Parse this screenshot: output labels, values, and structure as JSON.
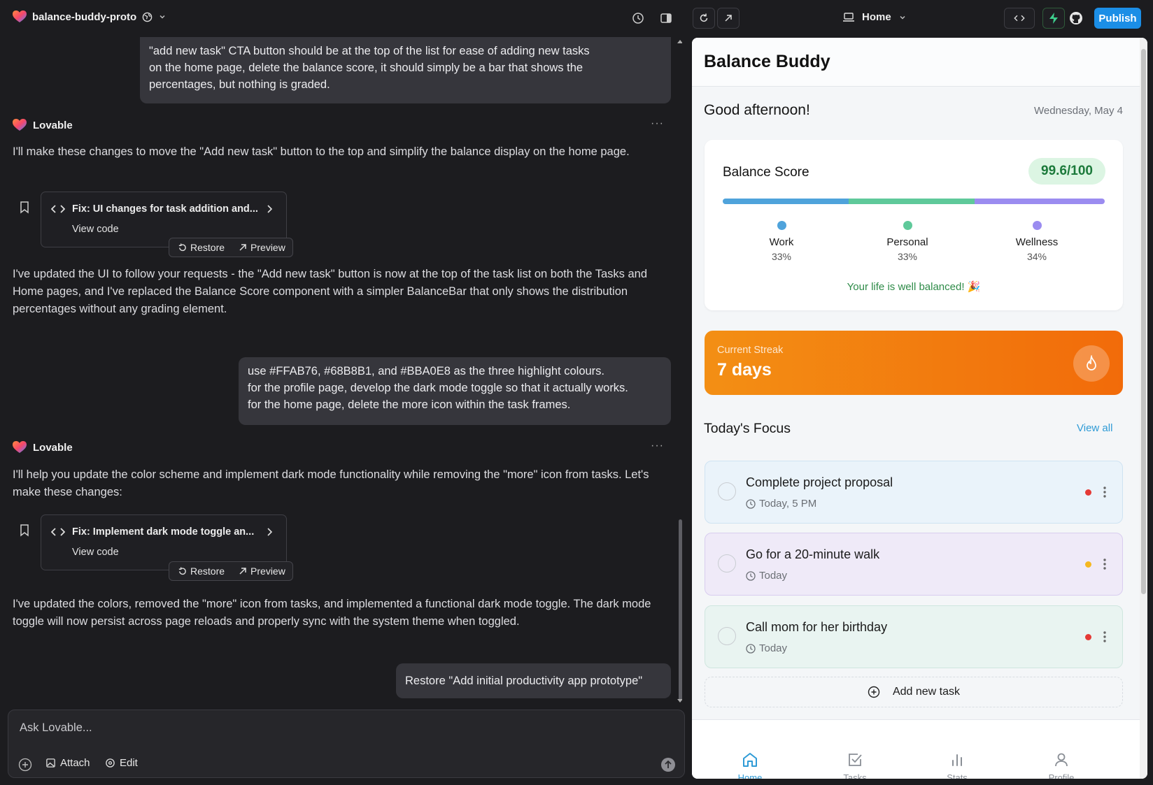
{
  "project": {
    "name": "balance-buddy-proto"
  },
  "chat": {
    "user_msg_1": [
      "\"add new task\" CTA button should be at the top of the list for ease of adding new tasks",
      "on the home page, delete the balance score, it should simply be a bar that shows the",
      "percentages, but nothing is graded."
    ],
    "author": "Lovable",
    "reply_1": "I'll make these changes to move the \"Add new task\" button to the top and simplify the balance display on the home page.",
    "card_1": {
      "title": "Fix: UI changes for task addition and...",
      "view": "View code"
    },
    "restore": "Restore",
    "preview": "Preview",
    "summary_1": "I've updated the UI to follow your requests - the \"Add new task\" button is now at the top of the task list on both the Tasks and Home pages, and I've replaced the Balance Score component with a simpler BalanceBar that only shows the distribution percentages without any grading element.",
    "user_msg_2": [
      "use #FFAB76, #68B8B1, and #BBA0E8 as the three highlight colours.",
      "for the profile page, develop the dark mode toggle so that it actually works.",
      "for the home page, delete the more icon within the task frames."
    ],
    "reply_2": "I'll help you update the color scheme and implement dark mode functionality while removing the \"more\" icon from tasks. Let's make these changes:",
    "card_2": {
      "title": "Fix: Implement dark mode toggle an...",
      "view": "View code"
    },
    "summary_2": "I've updated the colors, removed the \"more\" icon from tasks, and implemented a functional dark mode toggle. The dark mode toggle will now persist across page reloads and properly sync with the system theme when toggled.",
    "user_msg_3": "Restore \"Add initial productivity app prototype\""
  },
  "composer": {
    "placeholder": "Ask Lovable...",
    "attach": "Attach",
    "edit": "Edit"
  },
  "toolbar": {
    "route": "Home",
    "publish": "Publish"
  },
  "app": {
    "title": "Balance Buddy",
    "greeting": "Good afternoon!",
    "date": "Wednesday, May 4",
    "balance": {
      "label": "Balance Score",
      "score": "99.6/100",
      "categories": [
        {
          "name": "Work",
          "pct": "33%",
          "fraction": 0.33,
          "color": "#4fa3db"
        },
        {
          "name": "Personal",
          "pct": "33%",
          "fraction": 0.33,
          "color": "#5fc99a"
        },
        {
          "name": "Wellness",
          "pct": "34%",
          "fraction": 0.34,
          "color": "#9b8cf0"
        }
      ],
      "message": "Your life is well balanced! 🎉"
    },
    "streak": {
      "label": "Current Streak",
      "value": "7 days"
    },
    "focus": {
      "title": "Today's Focus",
      "view_all": "View all"
    },
    "tasks": [
      {
        "title": "Complete project proposal",
        "time": "Today, 5 PM",
        "priority_color": "#e53935",
        "bg": "#eaf3fa",
        "border": "#cfe3f2"
      },
      {
        "title": "Go for a 20-minute walk",
        "time": "Today",
        "priority_color": "#f5b820",
        "bg": "#efeaf8",
        "border": "#d8cdef"
      },
      {
        "title": "Call mom for her birthday",
        "time": "Today",
        "priority_color": "#e53935",
        "bg": "#e9f4f1",
        "border": "#cfe6df"
      }
    ],
    "add_task": "Add new task",
    "nav": [
      "Home",
      "Tasks",
      "Stats",
      "Profile"
    ]
  }
}
